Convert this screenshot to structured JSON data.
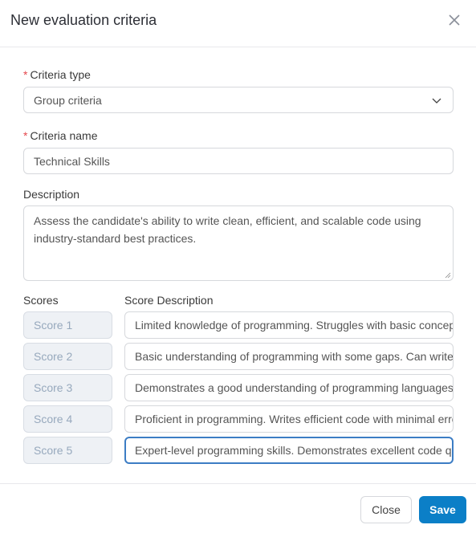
{
  "dialog": {
    "title": "New evaluation criteria",
    "close_icon": "close-x-icon"
  },
  "form": {
    "criteria_type": {
      "required_mark": "*",
      "label": "Criteria type",
      "value": "Group criteria",
      "icon": "chevron-down-icon"
    },
    "criteria_name": {
      "required_mark": "*",
      "label": "Criteria name",
      "value": "Technical Skills"
    },
    "description": {
      "label": "Description",
      "value": "Assess the candidate's ability to write clean, efficient, and scalable code using industry-standard best practices."
    },
    "scores_header": "Scores",
    "score_description_header": "Score Description",
    "scores": [
      {
        "label": "Score 1",
        "description": "Limited knowledge of programming. Struggles with basic concepts."
      },
      {
        "label": "Score 2",
        "description": "Basic understanding of programming with some gaps. Can write simple code."
      },
      {
        "label": "Score 3",
        "description": "Demonstrates a good understanding of programming languages and concepts."
      },
      {
        "label": "Score 4",
        "description": "Proficient in programming. Writes efficient code with minimal errors."
      },
      {
        "label": "Score 5",
        "description": "Expert-level programming skills. Demonstrates excellent code quality."
      }
    ]
  },
  "footer": {
    "close_label": "Close",
    "save_label": "Save"
  }
}
